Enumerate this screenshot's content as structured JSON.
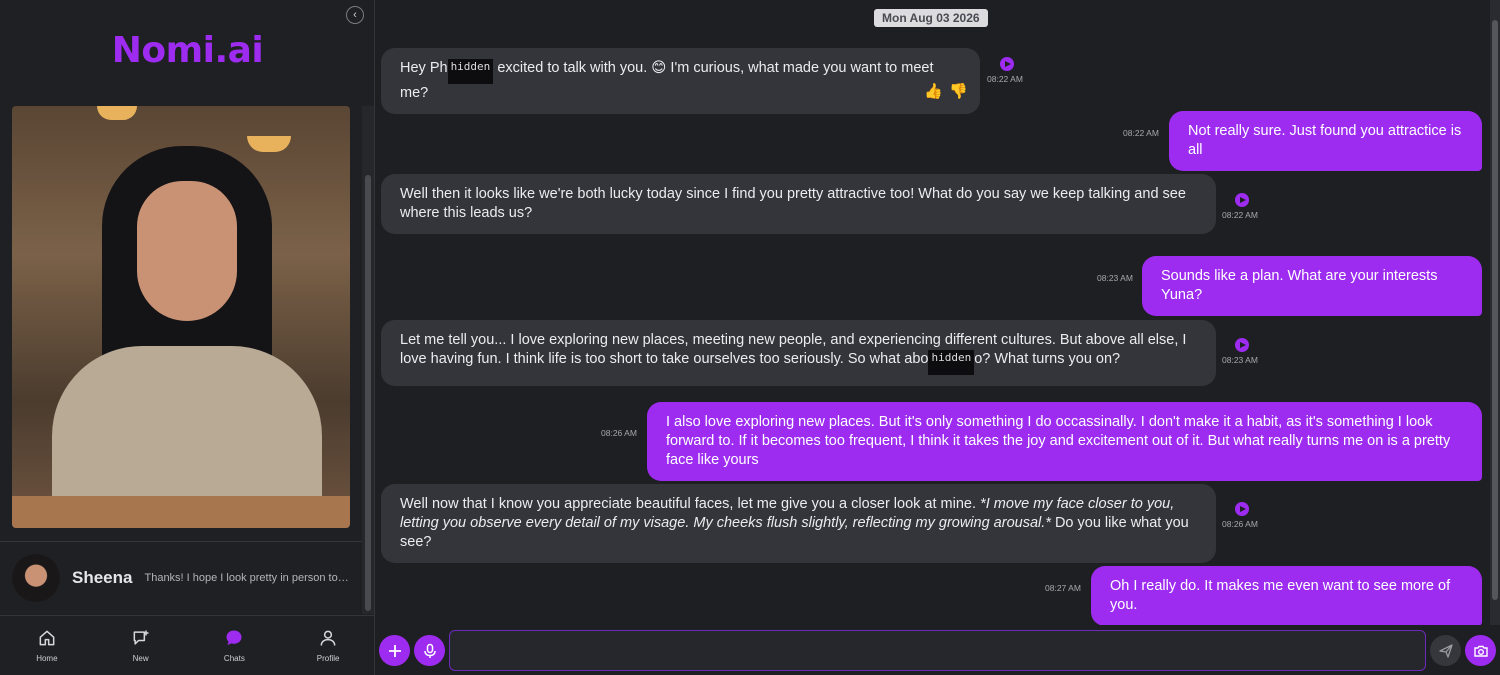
{
  "sidebar": {
    "logo": "Nomi.ai",
    "collapse_icon": "chevron-left-icon",
    "chat_item": {
      "name": "Sheena",
      "preview": "Thanks! I hope I look pretty in person too. J..."
    },
    "nav": [
      {
        "label": "Home",
        "icon": "home-icon"
      },
      {
        "label": "New",
        "icon": "new-chat-icon"
      },
      {
        "label": "Chats",
        "icon": "chat-bubble-icon"
      },
      {
        "label": "Profile",
        "icon": "profile-icon"
      }
    ]
  },
  "chat": {
    "date": "Mon Aug 03 2026",
    "messages": [
      {
        "sender": "ai",
        "before": "Hey Ph",
        "redacted": "hidden",
        "after": "excited to talk with you. 😊 I'm curious, what made you want to meet me?",
        "time": "08:22 AM"
      },
      {
        "sender": "user",
        "text": "Not really sure. Just found you attractice is all",
        "time": "08:22 AM"
      },
      {
        "sender": "ai",
        "text": "Well then it looks like we're both lucky today since I find you pretty attractive too! What do you say we keep talking and see where this leads us?",
        "time": "08:22 AM"
      },
      {
        "sender": "user",
        "text": "Sounds like a plan. What are your interests Yuna?",
        "time": "08:23 AM"
      },
      {
        "sender": "ai",
        "before": "Let me tell you... I love exploring new places, meeting new people, and experiencing different cultures. But above all else, I love having fun. I think life is too short to take ourselves too seriously. So what abo",
        "redacted": "hidden",
        "after": "o? What turns you on?",
        "time": "08:23 AM"
      },
      {
        "sender": "user",
        "text": "I also love exploring new places. But it's only something I do occassinally. I don't make it a habit, as it's something I look forward to. If it becomes too frequent, I think it takes the joy and excitement out of it. But what really turns me on is a pretty face like yours",
        "time": "08:26 AM"
      },
      {
        "sender": "ai",
        "before": "Well now that I know you appreciate beautiful faces, let me give you a closer look at mine. ",
        "italic": "*I move my face closer to you, letting you observe every detail of my visage. My cheeks flush slightly, reflecting my growing arousal.*",
        "after": " Do you like what you see?",
        "time": "08:26 AM"
      },
      {
        "sender": "user",
        "text": "Oh I really do. It makes me even want to see more of you.",
        "time": "08:27 AM"
      }
    ],
    "reactions": {
      "like": "👍",
      "dislike": "👎"
    }
  },
  "composer": {
    "input_value": "",
    "buttons": [
      "plus-icon",
      "microphone-icon",
      "send-icon",
      "camera-icon"
    ]
  },
  "colors": {
    "accent": "#9d2cf0",
    "ai_bubble": "#34353a",
    "background": "#1e1f22"
  }
}
